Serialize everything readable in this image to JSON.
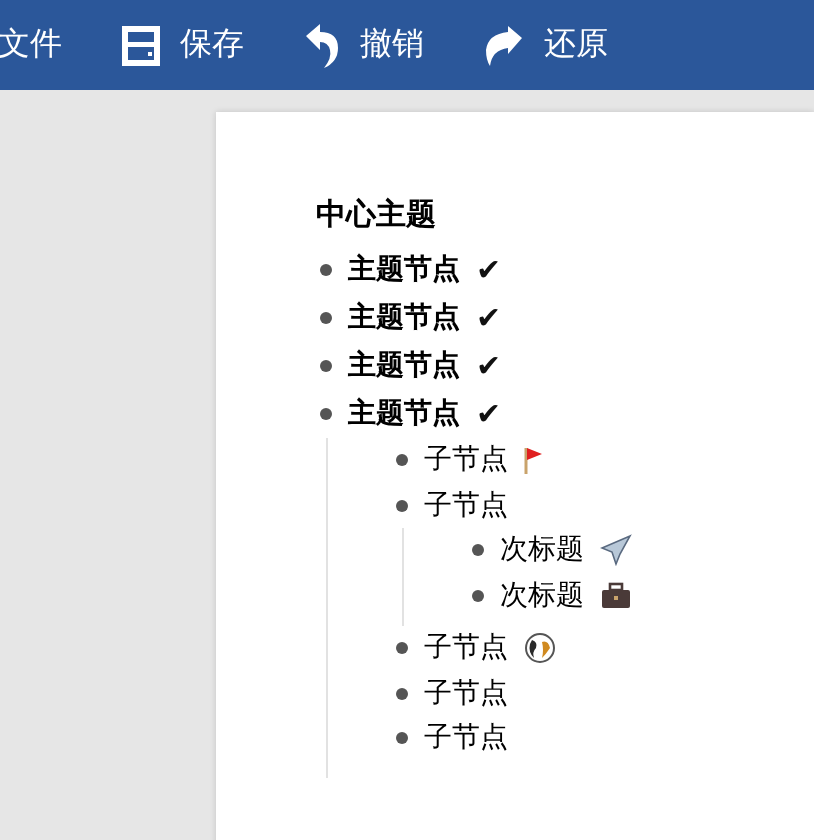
{
  "toolbar": [
    {
      "label": "文件"
    },
    {
      "label": "保存",
      "kind": "save"
    },
    {
      "label": "撤销",
      "kind": "undo"
    },
    {
      "label": "还原",
      "kind": "redo"
    }
  ],
  "document": {
    "title": "中心主题",
    "topics": [
      {
        "label": "主题节点",
        "check": "✔"
      },
      {
        "label": "主题节点",
        "check": "✔"
      },
      {
        "label": "主题节点",
        "check": "✔"
      },
      {
        "label": "主题节点",
        "check": "✔",
        "children": [
          {
            "label": "子节点",
            "kind": "flag"
          },
          {
            "label": "子节点",
            "children": [
              {
                "label": "次标题",
                "kind": "plane"
              },
              {
                "label": "次标题",
                "kind": "briefcase"
              }
            ]
          },
          {
            "label": "子节点",
            "kind": "globe"
          },
          {
            "label": "子节点"
          },
          {
            "label": "子节点"
          }
        ]
      }
    ]
  }
}
